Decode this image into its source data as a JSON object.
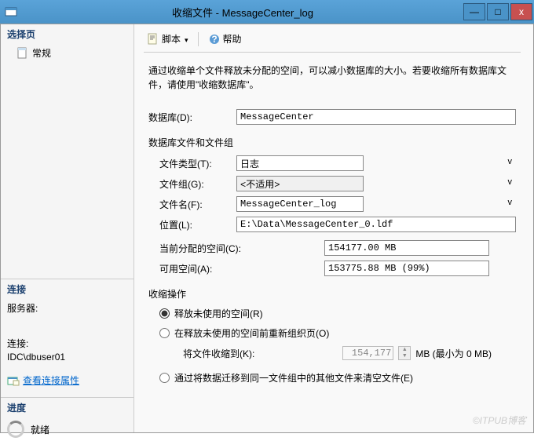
{
  "window": {
    "title": "收缩文件 - MessageCenter_log",
    "min": "—",
    "max": "□",
    "close": "x"
  },
  "sidebar": {
    "select_page": "选择页",
    "general": "常规",
    "connection": "连接",
    "server_label": "服务器:",
    "server_value": "",
    "conn_label": "连接:",
    "conn_value": "IDC\\dbuser01",
    "view_props": "查看连接属性",
    "progress": "进度",
    "ready": "就绪"
  },
  "toolbar": {
    "script": "脚本",
    "help": "帮助"
  },
  "main": {
    "description": "通过收缩单个文件释放未分配的空间，可以减小数据库的大小。若要收缩所有数据库文件，请使用\"收缩数据库\"。",
    "db_label": "数据库(D):",
    "db_value": "MessageCenter",
    "files_section": "数据库文件和文件组",
    "filetype_label": "文件类型(T):",
    "filetype_value": "日志",
    "filegroup_label": "文件组(G):",
    "filegroup_value": "<不适用>",
    "filename_label": "文件名(F):",
    "filename_value": "MessageCenter_log",
    "location_label": "位置(L):",
    "location_value": "E:\\Data\\MessageCenter_0.ldf",
    "allocated_label": "当前分配的空间(C):",
    "allocated_value": "154177.00 MB",
    "available_label": "可用空间(A):",
    "available_value": "153775.88 MB (99%)",
    "shrink_section": "收缩操作",
    "radio_release": "释放未使用的空间(R)",
    "radio_reorg": "在释放未使用的空间前重新组织页(O)",
    "shrink_to_label": "将文件收缩到(K):",
    "shrink_to_value": "154,177",
    "shrink_to_unit": "MB (最小为 0 MB)",
    "radio_empty": "通过将数据迁移到同一文件组中的其他文件来清空文件(E)"
  },
  "watermark": "©ITPUB博客"
}
